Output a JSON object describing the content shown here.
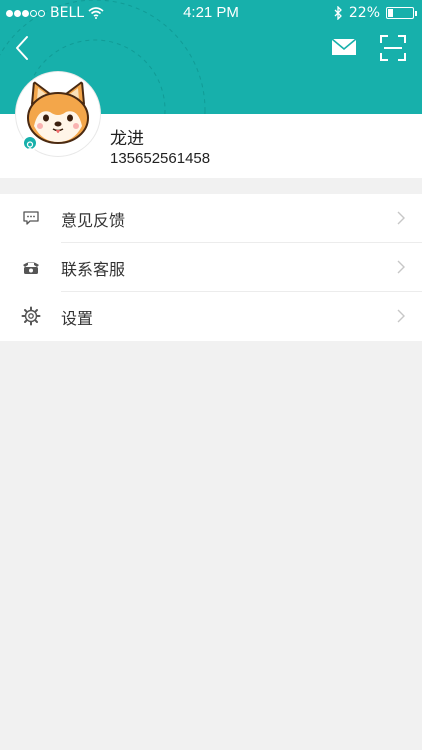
{
  "status_bar": {
    "carrier": "BELL",
    "time": "4:21 PM",
    "battery": "22%",
    "battery_level": 0.22
  },
  "header": {
    "back_icon": "chevron-left-icon",
    "mail_icon": "mail-icon",
    "scan_icon": "scan-icon"
  },
  "profile": {
    "name": "龙进",
    "phone": "135652561458",
    "gender_icon": "female-icon"
  },
  "menu": {
    "items": [
      {
        "label": "意见反馈",
        "icon": "feedback-chat-icon"
      },
      {
        "label": "联系客服",
        "icon": "telephone-icon"
      },
      {
        "label": "设置",
        "icon": "gear-icon"
      }
    ]
  },
  "colors": {
    "accent": "#17b0ab",
    "background": "#f1f1f1"
  }
}
